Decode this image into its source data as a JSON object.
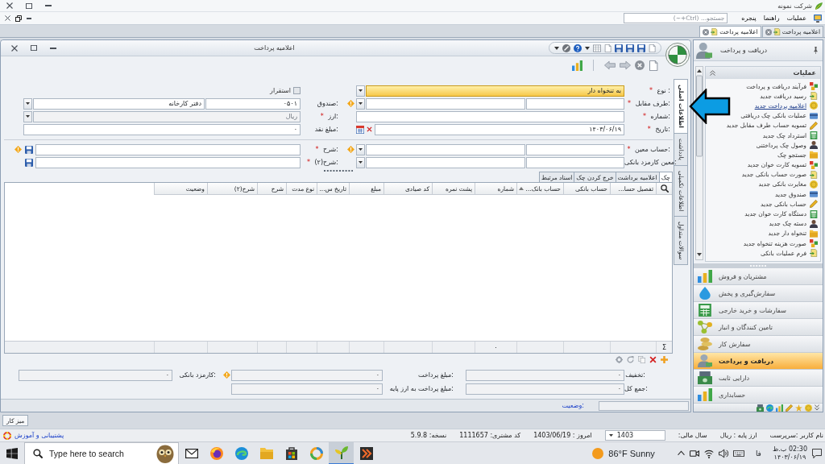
{
  "app": {
    "title": "شرکت نمونه"
  },
  "menu": {
    "items": [
      "عملیات",
      "راهنما",
      "پنجره"
    ],
    "search": {
      "placeholder": "جستجو... (Ctrl+~)"
    }
  },
  "document_tabs": [
    {
      "label": "اعلامیه پرداخت",
      "selected": false
    },
    {
      "label": "اعلامیه پرداخت",
      "selected": true
    }
  ],
  "form_window": {
    "title": "اعلامیه پرداخت",
    "side_tabs": [
      {
        "label": "اطلاعات اصلی",
        "selected": true
      },
      {
        "label": "یادداشت",
        "selected": false
      },
      {
        "label": "اطلاعات تکمیلی",
        "selected": false
      },
      {
        "label": "سوالات متداول",
        "selected": false
      }
    ],
    "field_groups": [
      {
        "rows": [
          {
            "main": {
              "kind": "combo",
              "label": "نوع :",
              "required_mark": "*",
              "value": "به تنخواه دار",
              "focused": true,
              "warning": false
            },
            "side": {
              "kind": "checkbox",
              "label": "استقرار",
              "checked": false,
              "disabled": true,
              "warning": false
            }
          },
          {
            "main": {
              "kind": "lookup",
              "label": "طرف مقابل:",
              "required_mark": "*",
              "focused": false,
              "warning": true
            },
            "side": {
              "kind": "lookup",
              "label": "صندوق:",
              "code": "۰۵۰۱",
              "value": "دفتر کارخانه",
              "disabled": false,
              "warning": false
            }
          },
          {
            "main": {
              "kind": "text",
              "label": "شماره:",
              "required_mark": "*",
              "focused": false,
              "warning": false
            },
            "side": {
              "kind": "combo",
              "label": "ارز:",
              "required_mark": "*",
              "value": "ریال",
              "disabled": true,
              "warning": false
            }
          },
          {
            "main": {
              "kind": "date",
              "label": "تاریخ:",
              "required_mark": "*",
              "value": "۱۴۰۳/۰۶/۱۹",
              "focused": false,
              "warning": false
            },
            "side": {
              "kind": "number",
              "label": "مبلغ نقد:",
              "value": "۰",
              "disabled": false,
              "warning": false
            }
          }
        ]
      },
      {
        "rows": [
          {
            "main": {
              "kind": "lookup",
              "label": "حساب معین:",
              "required_mark": "*",
              "focused": false,
              "warning": true
            },
            "side": {
              "kind": "note",
              "label": "شرح:",
              "required_mark": "*",
              "disabled": false,
              "warning": true
            }
          },
          {
            "main": {
              "kind": "lookup",
              "label": "معین کارمزد بانکی:",
              "focused": false,
              "warning": false
            },
            "side": {
              "kind": "note",
              "label": "شرح(۲):",
              "required_mark": "*",
              "disabled": false,
              "warning": false
            }
          }
        ]
      }
    ],
    "detail_tabs": [
      {
        "label": "چک",
        "selected": true
      },
      {
        "label": "اعلامیه برداشت",
        "selected": false
      },
      {
        "label": "خرج کردن چک",
        "selected": false
      },
      {
        "label": "اسناد مرتبط",
        "selected": false
      }
    ],
    "grid": {
      "footer_symbol": "Σ",
      "columns": [
        {
          "label": "تفصیل حسا...",
          "sorted": false
        },
        {
          "label": "حساب بانکی",
          "sorted": false
        },
        {
          "label": "حساب بانک...",
          "sorted": true
        },
        {
          "label": "شماره",
          "sorted": false,
          "footer": "۰"
        },
        {
          "label": "پشت نمره",
          "sorted": false
        },
        {
          "label": "کد صیادی",
          "sorted": false
        },
        {
          "label": "مبلغ",
          "sorted": false
        },
        {
          "label": "تاریخ س...",
          "sorted": false
        },
        {
          "label": "نوع مدت",
          "sorted": false
        },
        {
          "label": "شرح",
          "sorted": false
        },
        {
          "label": "شرح(۲)",
          "sorted": false
        },
        {
          "label": "وضعیت",
          "sorted": false
        }
      ]
    },
    "totals": [
      [
        {
          "label": "تخفیف:",
          "value": "۰",
          "warning": false
        },
        {
          "label": "مبلغ پرداخت:",
          "value": "۰",
          "warning": true
        },
        {
          "label": "کارمزد بانکی:",
          "value": "۰",
          "warning": false
        }
      ],
      [
        {
          "label": "جمع کل:",
          "value": "۰",
          "warning": false
        },
        {
          "label": "مبلغ پرداخت به ارز پایه:",
          "value": "۰",
          "warning": false
        }
      ]
    ],
    "status": {
      "label": "وضعیت:"
    }
  },
  "sidebar": {
    "title": "دریافت و پرداخت",
    "section": {
      "title": "عملیات",
      "expanded": true,
      "items": [
        {
          "label": "فرآیند دریافت و پرداخت",
          "selected": false
        },
        {
          "label": "رسید دریافت جدید",
          "selected": false
        },
        {
          "label": "اعلامیه پرداخت جدید",
          "selected": true
        },
        {
          "label": "عملیات بانکی چک دریافتی",
          "selected": false
        },
        {
          "label": "تسویه حساب طرف مقابل جدید",
          "selected": false
        },
        {
          "label": "استرداد چک جدید",
          "selected": false
        },
        {
          "label": "وصول چک پرداختنی",
          "selected": false
        },
        {
          "label": "جستجو چک",
          "selected": false
        },
        {
          "label": "تسویه کارت خوان جدید",
          "selected": false
        },
        {
          "label": "صورت حساب بانکی جدید",
          "selected": false
        },
        {
          "label": "مغایرت بانکی جدید",
          "selected": false
        },
        {
          "label": "صندوق جدید",
          "selected": false
        },
        {
          "label": "حساب بانکی جدید",
          "selected": false
        },
        {
          "label": "دستگاه کارت خوان جدید",
          "selected": false
        },
        {
          "label": "دسته چک جدید",
          "selected": false
        },
        {
          "label": "تنخواه دار جدید",
          "selected": false
        },
        {
          "label": "صورت هزینه تنخواه جدید",
          "selected": false
        },
        {
          "label": "فرم عملیات بانکی",
          "selected": false
        }
      ]
    },
    "modules": [
      {
        "label": "مشتریان و فروش",
        "selected": false
      },
      {
        "label": "سفارش‌گیری و پخش",
        "selected": false
      },
      {
        "label": "سفارشات و خرید خارجی",
        "selected": false
      },
      {
        "label": "تامین کنندگان و انبار",
        "selected": false
      },
      {
        "label": "سفارش کار",
        "selected": false
      },
      {
        "label": "دریافت و پرداخت",
        "selected": true
      },
      {
        "label": "دارایی ثابت",
        "selected": false
      },
      {
        "label": "حسابداری",
        "selected": false
      }
    ]
  },
  "desktop_tab": {
    "label": "میز کار"
  },
  "status_bar": {
    "items": [
      "نام کاربر :سرپرست",
      "ارز پایه : ریال",
      "سال مالی:"
    ],
    "fiscal_year": "1403",
    "info": [
      "امروز : 1403/06/19",
      "کد مشتری: 1111657",
      "نسخه: 5.9.8"
    ],
    "support": "پشتیبانی و آموزش"
  },
  "taskbar": {
    "search": {
      "placeholder": "Type here to search"
    },
    "apps": [
      {
        "kind": "mail",
        "selected": false
      },
      {
        "kind": "globe",
        "selected": false
      },
      {
        "kind": "swirl",
        "selected": false
      },
      {
        "kind": "folder",
        "selected": false
      },
      {
        "kind": "bag",
        "selected": false
      },
      {
        "kind": "ring",
        "selected": false
      },
      {
        "kind": "sprout",
        "selected": true
      },
      {
        "kind": "chevron",
        "selected": false
      }
    ],
    "weather": "86°F Sunny",
    "language": "فا",
    "time": "02:30 ب.ظ",
    "date": "۱۴۰۳/۰۶/۱۹"
  }
}
